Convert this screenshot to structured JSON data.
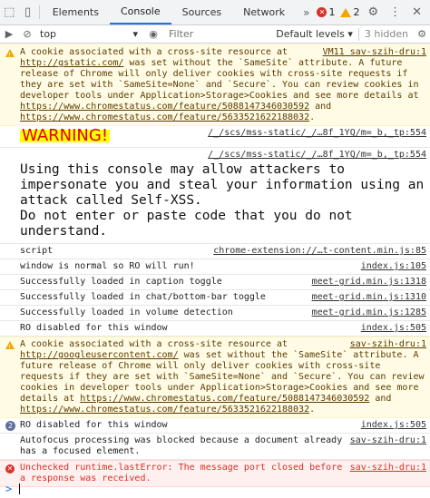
{
  "tabs": {
    "elements": "Elements",
    "console": "Console",
    "sources": "Sources",
    "network": "Network",
    "more": "»",
    "error_count": "1",
    "warning_count": "2"
  },
  "filter": {
    "context": "top",
    "placeholder": "Filter",
    "levels": "Default levels ▾",
    "hidden": "3 hidden"
  },
  "messages": {
    "m1": {
      "src": "VM11 sav-szih-dru:1",
      "parts": [
        "A cookie associated with a cross-site resource at ",
        "http://gstatic.com/",
        " was set without the `SameSite` attribute. A future release of Chrome will only deliver cookies with cross-site requests if they are set with `SameSite=None` and `Secure`. You can review cookies in developer tools under Application>Storage>Cookies and see more details at ",
        "https://www.chromestatus.com/feature/5088147346030592",
        " and ",
        "https://www.chromestatus.com/feature/5633521622188032",
        "."
      ]
    },
    "m2": {
      "src": "/_/scs/mss-static/_/…8f_1YQ/m=_b,_tp:554",
      "text": "WARNING!"
    },
    "m3": {
      "src": "/_/scs/mss-static/_/…8f_1YQ/m=_b,_tp:554",
      "text": "Using this console may allow attackers to impersonate you and steal your information using an attack called Self-XSS.\nDo not enter or paste code that you do not understand."
    },
    "m4": {
      "text": "script",
      "src": "chrome-extension://…t-content.min.js:85"
    },
    "m5": {
      "text": "window is normal so RO will run!",
      "src": "index.js:105"
    },
    "m6": {
      "text": "Successfully loaded in caption toggle",
      "src": "meet-grid.min.js:1318"
    },
    "m7": {
      "text": "Successfully loaded in chat/bottom-bar toggle",
      "src": "meet-grid.min.js:1310"
    },
    "m8": {
      "text": "Successfully loaded in volume detection",
      "src": "meet-grid.min.js:1285"
    },
    "m9": {
      "text": "RO disabled for this window",
      "src": "index.js:505"
    },
    "m10": {
      "src": "sav-szih-dru:1",
      "parts": [
        "A cookie associated with a cross-site resource at ",
        "http://googleusercontent.com/",
        " was set without the `SameSite` attribute. A future release of Chrome will only deliver cookies with cross-site requests if they are set with `SameSite=None` and `Secure`. You can review cookies in developer tools under Application>Storage>Cookies and see more details at ",
        "https://www.chromestatus.com/feature/5088147346030592",
        " and ",
        "https://www.chromestatus.com/feature/5633521622188032",
        "."
      ]
    },
    "m11": {
      "text": "RO disabled for this window",
      "src": "index.js:505",
      "repeat": "2"
    },
    "m12": {
      "text": "Autofocus processing was blocked because a document already has a focused element.",
      "src": "sav-szih-dru:1"
    },
    "m13": {
      "text": "Unchecked runtime.lastError: The message port closed before a response was received.",
      "src": "sav-szih-dru:1"
    }
  },
  "prompt": ">"
}
